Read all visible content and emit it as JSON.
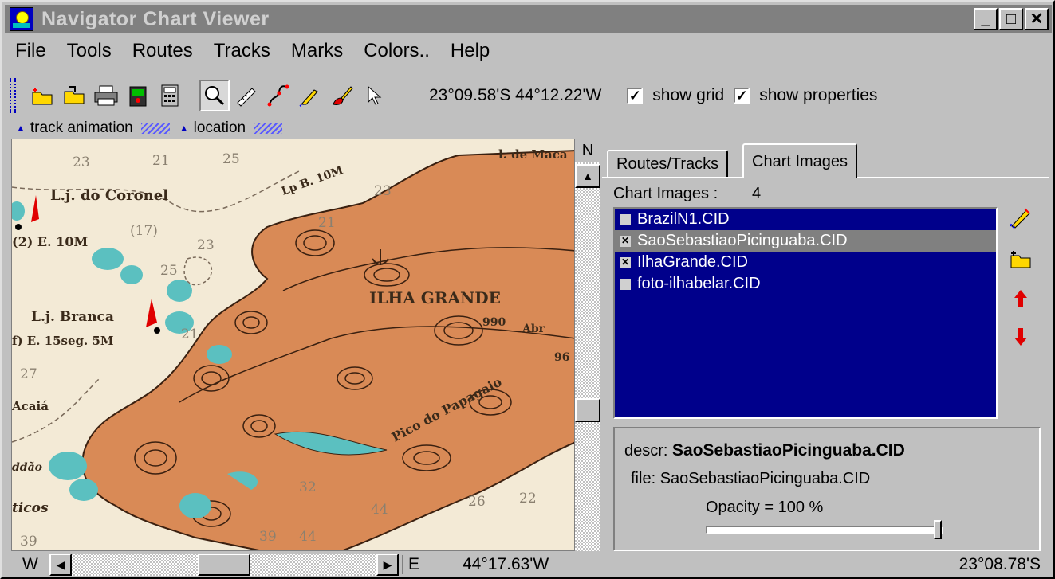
{
  "window": {
    "title": "Navigator Chart Viewer",
    "minimize": "_",
    "maximize": "□",
    "close": "✕"
  },
  "menu": [
    "File",
    "Tools",
    "Routes",
    "Tracks",
    "Marks",
    "Colors..",
    "Help"
  ],
  "toolbar": {
    "coordinates": "23°09.58'S 44°12.22'W",
    "show_grid": "show grid",
    "show_properties": "show properties",
    "show_grid_checked": true,
    "show_properties_checked": true
  },
  "subbars": [
    "track animation",
    "location"
  ],
  "map": {
    "north_label": "N",
    "labels": [
      "L.j. do Coronel",
      "(2) E. 10M",
      "L.j. Branca",
      "f) E. 15seg. 5M",
      "ILHA GRANDE",
      "Pico do Papagaio",
      "Lp B. 10M",
      "l. de Maca",
      "Acaiá",
      "Abr",
      "990",
      "96",
      "ticos",
      "ddão",
      "23",
      "21",
      "25",
      "23",
      "21",
      "(17)",
      "23",
      "25",
      "21",
      "27",
      "32",
      "44",
      "26",
      "22",
      "39",
      "39",
      "44"
    ]
  },
  "status": {
    "west": "W",
    "east": "E",
    "longitude": "44°17.63'W",
    "latitude": "23°08.78'S"
  },
  "panel": {
    "tabs": [
      "Routes/Tracks",
      "Chart Images"
    ],
    "active_tab": "Chart Images",
    "chart_images_label": "Chart Images :",
    "chart_images_count": "4",
    "items": [
      {
        "name": "BrazilN1.CID",
        "checked": false,
        "selected": false
      },
      {
        "name": "SaoSebastiaoPicinguaba.CID",
        "checked": true,
        "selected": true
      },
      {
        "name": "IlhaGrande.CID",
        "checked": true,
        "selected": false
      },
      {
        "name": "foto-ilhabelar.CID",
        "checked": false,
        "selected": false
      }
    ],
    "descr_label": "descr:",
    "descr_value": "SaoSebastiaoPicinguaba.CID",
    "file_label": "file:",
    "file_value": "SaoSebastiaoPicinguaba.CID",
    "opacity_text": "Opacity =  100 %",
    "opacity_value": 100
  },
  "colors": {
    "titlebar": "#808080",
    "listbox": "#00008b",
    "land": "#d98a56",
    "sea": "#f3ead6",
    "shoal": "#5bc0c0"
  }
}
